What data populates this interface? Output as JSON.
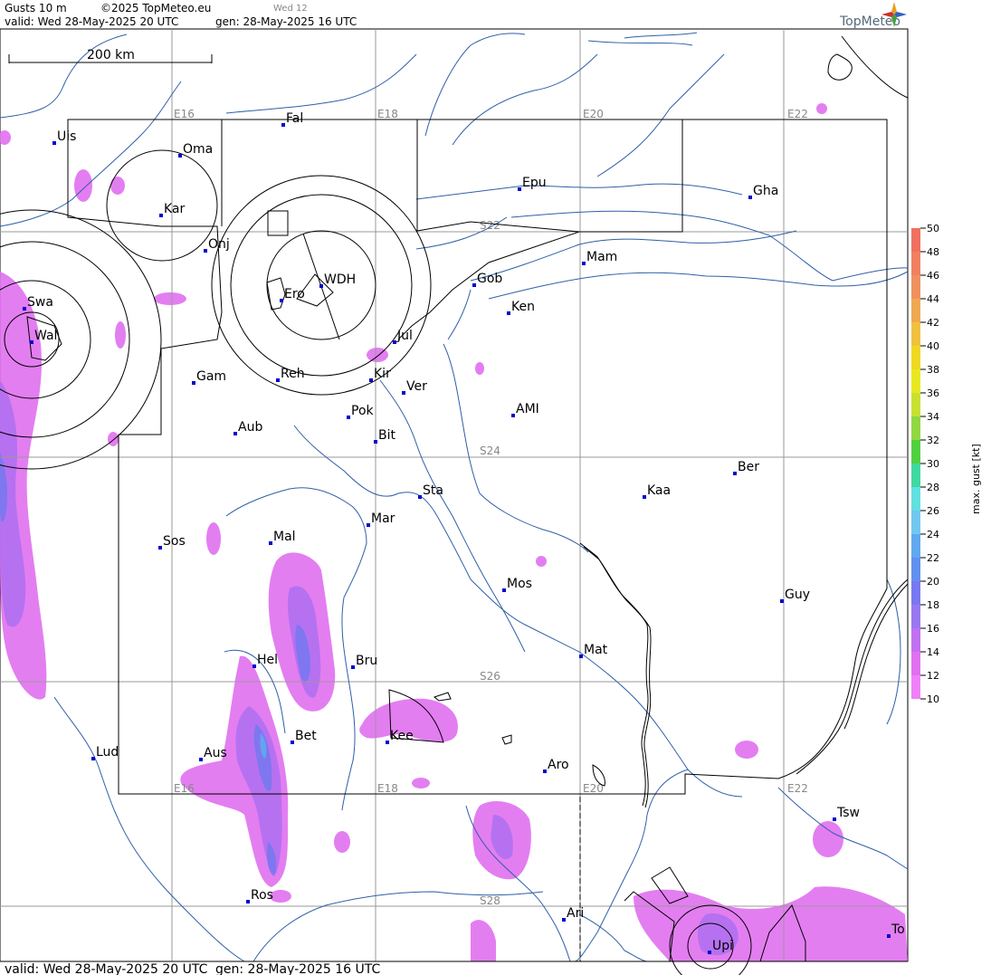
{
  "header": {
    "product": "Gusts 10 m",
    "copyright": "©2025 TopMeteo.eu",
    "step": "Wed 12",
    "valid": "valid:  Wed  28-May-2025  20 UTC",
    "gen": "gen: 28-May-2025 16 UTC",
    "brand": "TopMeteo"
  },
  "footer": {
    "valid": "valid:  Wed  28-May-2025  20 UTC",
    "gen": "gen: 28-May-2025 16 UTC"
  },
  "scale_bar": "200 km",
  "grid_labels": {
    "longitudes": [
      "E16",
      "E18",
      "E20",
      "E22"
    ],
    "latitudes": [
      "S22",
      "S24",
      "S26",
      "S28"
    ]
  },
  "cities": [
    {
      "name": "Uis"
    },
    {
      "name": "Fal"
    },
    {
      "name": "Oma"
    },
    {
      "name": "Kar"
    },
    {
      "name": "Epu"
    },
    {
      "name": "Gha"
    },
    {
      "name": "Onj"
    },
    {
      "name": "Mam"
    },
    {
      "name": "Gob"
    },
    {
      "name": "WDH"
    },
    {
      "name": "Ero"
    },
    {
      "name": "Ken"
    },
    {
      "name": "Swa"
    },
    {
      "name": "Wal"
    },
    {
      "name": "Jul"
    },
    {
      "name": "Gam"
    },
    {
      "name": "Reh"
    },
    {
      "name": "Kir"
    },
    {
      "name": "Ver"
    },
    {
      "name": "Pok"
    },
    {
      "name": "AMI"
    },
    {
      "name": "Aub"
    },
    {
      "name": "Bit"
    },
    {
      "name": "Ber"
    },
    {
      "name": "Sta"
    },
    {
      "name": "Kaa"
    },
    {
      "name": "Mar"
    },
    {
      "name": "Sos"
    },
    {
      "name": "Mal"
    },
    {
      "name": "Mos"
    },
    {
      "name": "Guy"
    },
    {
      "name": "Hel"
    },
    {
      "name": "Mat"
    },
    {
      "name": "Bru"
    },
    {
      "name": "Bet"
    },
    {
      "name": "Kee"
    },
    {
      "name": "Lud"
    },
    {
      "name": "Aus"
    },
    {
      "name": "Aro"
    },
    {
      "name": "Tsw"
    },
    {
      "name": "Ros"
    },
    {
      "name": "Ari"
    },
    {
      "name": "To"
    },
    {
      "name": "Upi"
    }
  ],
  "legend": {
    "title": "max. gust [kt]",
    "levels": [
      {
        "value": "50",
        "color": "#f07060"
      },
      {
        "value": "48",
        "color": "#f08060"
      },
      {
        "value": "46",
        "color": "#f09060"
      },
      {
        "value": "44",
        "color": "#f0a850"
      },
      {
        "value": "42",
        "color": "#f0c040"
      },
      {
        "value": "40",
        "color": "#f0d820"
      },
      {
        "value": "38",
        "color": "#e8e820"
      },
      {
        "value": "36",
        "color": "#c8e030"
      },
      {
        "value": "34",
        "color": "#90d840"
      },
      {
        "value": "32",
        "color": "#50d040"
      },
      {
        "value": "30",
        "color": "#40d8a0"
      },
      {
        "value": "28",
        "color": "#60e0e0"
      },
      {
        "value": "26",
        "color": "#70c8f0"
      },
      {
        "value": "24",
        "color": "#60a8f0"
      },
      {
        "value": "22",
        "color": "#6090f0"
      },
      {
        "value": "20",
        "color": "#7878f0"
      },
      {
        "value": "18",
        "color": "#9878f0"
      },
      {
        "value": "16",
        "color": "#c070f0"
      },
      {
        "value": "14",
        "color": "#e070f0"
      },
      {
        "value": "12",
        "color": "#f080f8"
      },
      {
        "value": "10",
        "color": "#ffffff"
      }
    ]
  },
  "colors": {
    "gust_light": "#e070f0",
    "gust_mid": "#b070f0",
    "gust_strong": "#7878f0",
    "gust_core": "#60a8f0",
    "river": "#2f5fa8",
    "border": "#000000",
    "grid": "#999999",
    "city_marker": "#0000cc"
  }
}
